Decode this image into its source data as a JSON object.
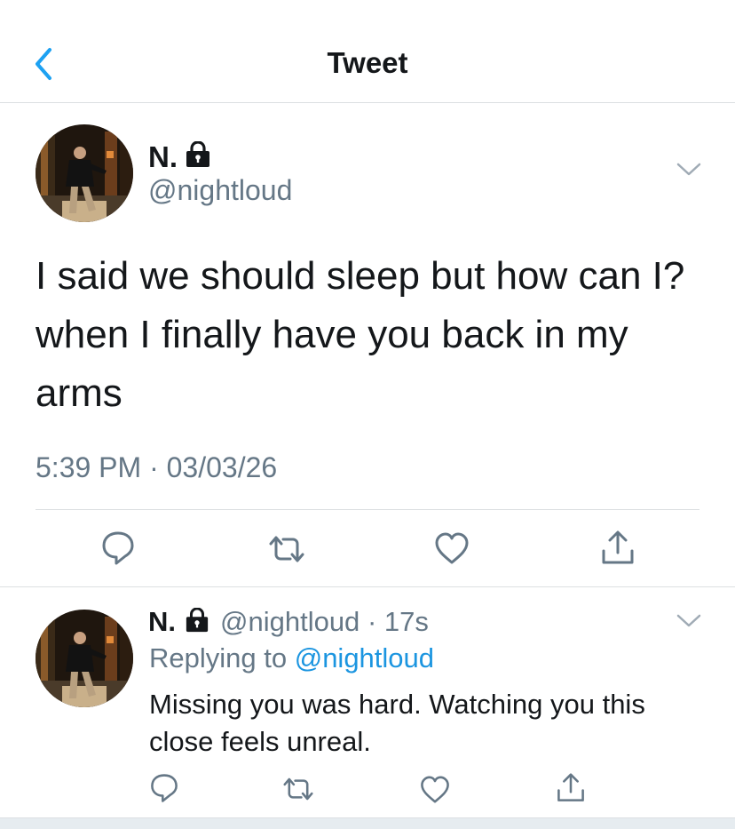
{
  "header": {
    "title": "Tweet",
    "back_icon": "chevron-left-icon",
    "accent_color": "#1da1f2"
  },
  "tweet": {
    "author_name": "N.",
    "protected_icon": "lock-icon",
    "handle": "@nightloud",
    "text": "I said we should sleep but how can I? when I finally have you back in my arms",
    "timestamp": "5:39 PM · 03/03/26",
    "actions": [
      "reply-icon",
      "retweet-icon",
      "like-icon",
      "share-icon"
    ]
  },
  "reply": {
    "author_name": "N.",
    "handle": "@nightloud",
    "separator": "·",
    "age": "17s",
    "replying_prefix": "Replying to",
    "replying_to": "@nightloud",
    "text": "Missing you was hard. Watching you this close feels unreal.",
    "actions": [
      "reply-icon",
      "retweet-icon",
      "like-icon",
      "share-icon"
    ]
  },
  "colors": {
    "text_primary": "#14171a",
    "text_secondary": "#657786",
    "link": "#1b95e0",
    "divider": "#dcdfe2"
  }
}
